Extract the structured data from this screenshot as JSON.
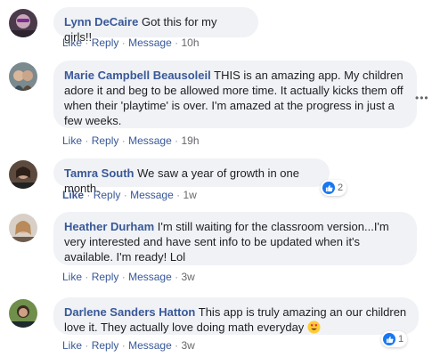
{
  "actions": {
    "like": "Like",
    "reply": "Reply",
    "message": "Message",
    "separator": "·"
  },
  "comments": [
    {
      "author": "Lynn DeCaire",
      "text": "Got this for my girls!!",
      "time": "10h",
      "reactions": null,
      "avatar_icon": "avatar-photo"
    },
    {
      "author": "Marie Campbell Beausoleil",
      "text": "THIS is an amazing app. My children adore it and beg to be allowed more time. It actually kicks them off when their 'playtime' is over. I'm amazed at the progress in just a few weeks.",
      "time": "19h",
      "reactions": null,
      "avatar_icon": "avatar-photo"
    },
    {
      "author": "Tamra South",
      "text": "We saw a year of growth in one month.",
      "time": "1w",
      "reactions": "2",
      "avatar_icon": "avatar-photo"
    },
    {
      "author": "Heather Durham",
      "text": "I'm still waiting for the classroom version...I'm very interested and have sent info to be updated when it's available. I'm ready! Lol",
      "time": "3w",
      "reactions": null,
      "avatar_icon": "avatar-photo"
    },
    {
      "author": "Darlene Sanders Hatton",
      "text": "This app is truly amazing an our children love it. They actually love doing math everyday",
      "time": "3w",
      "reactions": "1",
      "avatar_icon": "avatar-photo",
      "trailing_emoji": "heart-eyes-emoji"
    }
  ],
  "more_menu_icon": "more-options-icon",
  "colors": {
    "link": "#385898",
    "bubble": "#f0f2f5",
    "like_blue": "#1877f2",
    "text": "#1c1e21",
    "muted": "#65676b"
  }
}
